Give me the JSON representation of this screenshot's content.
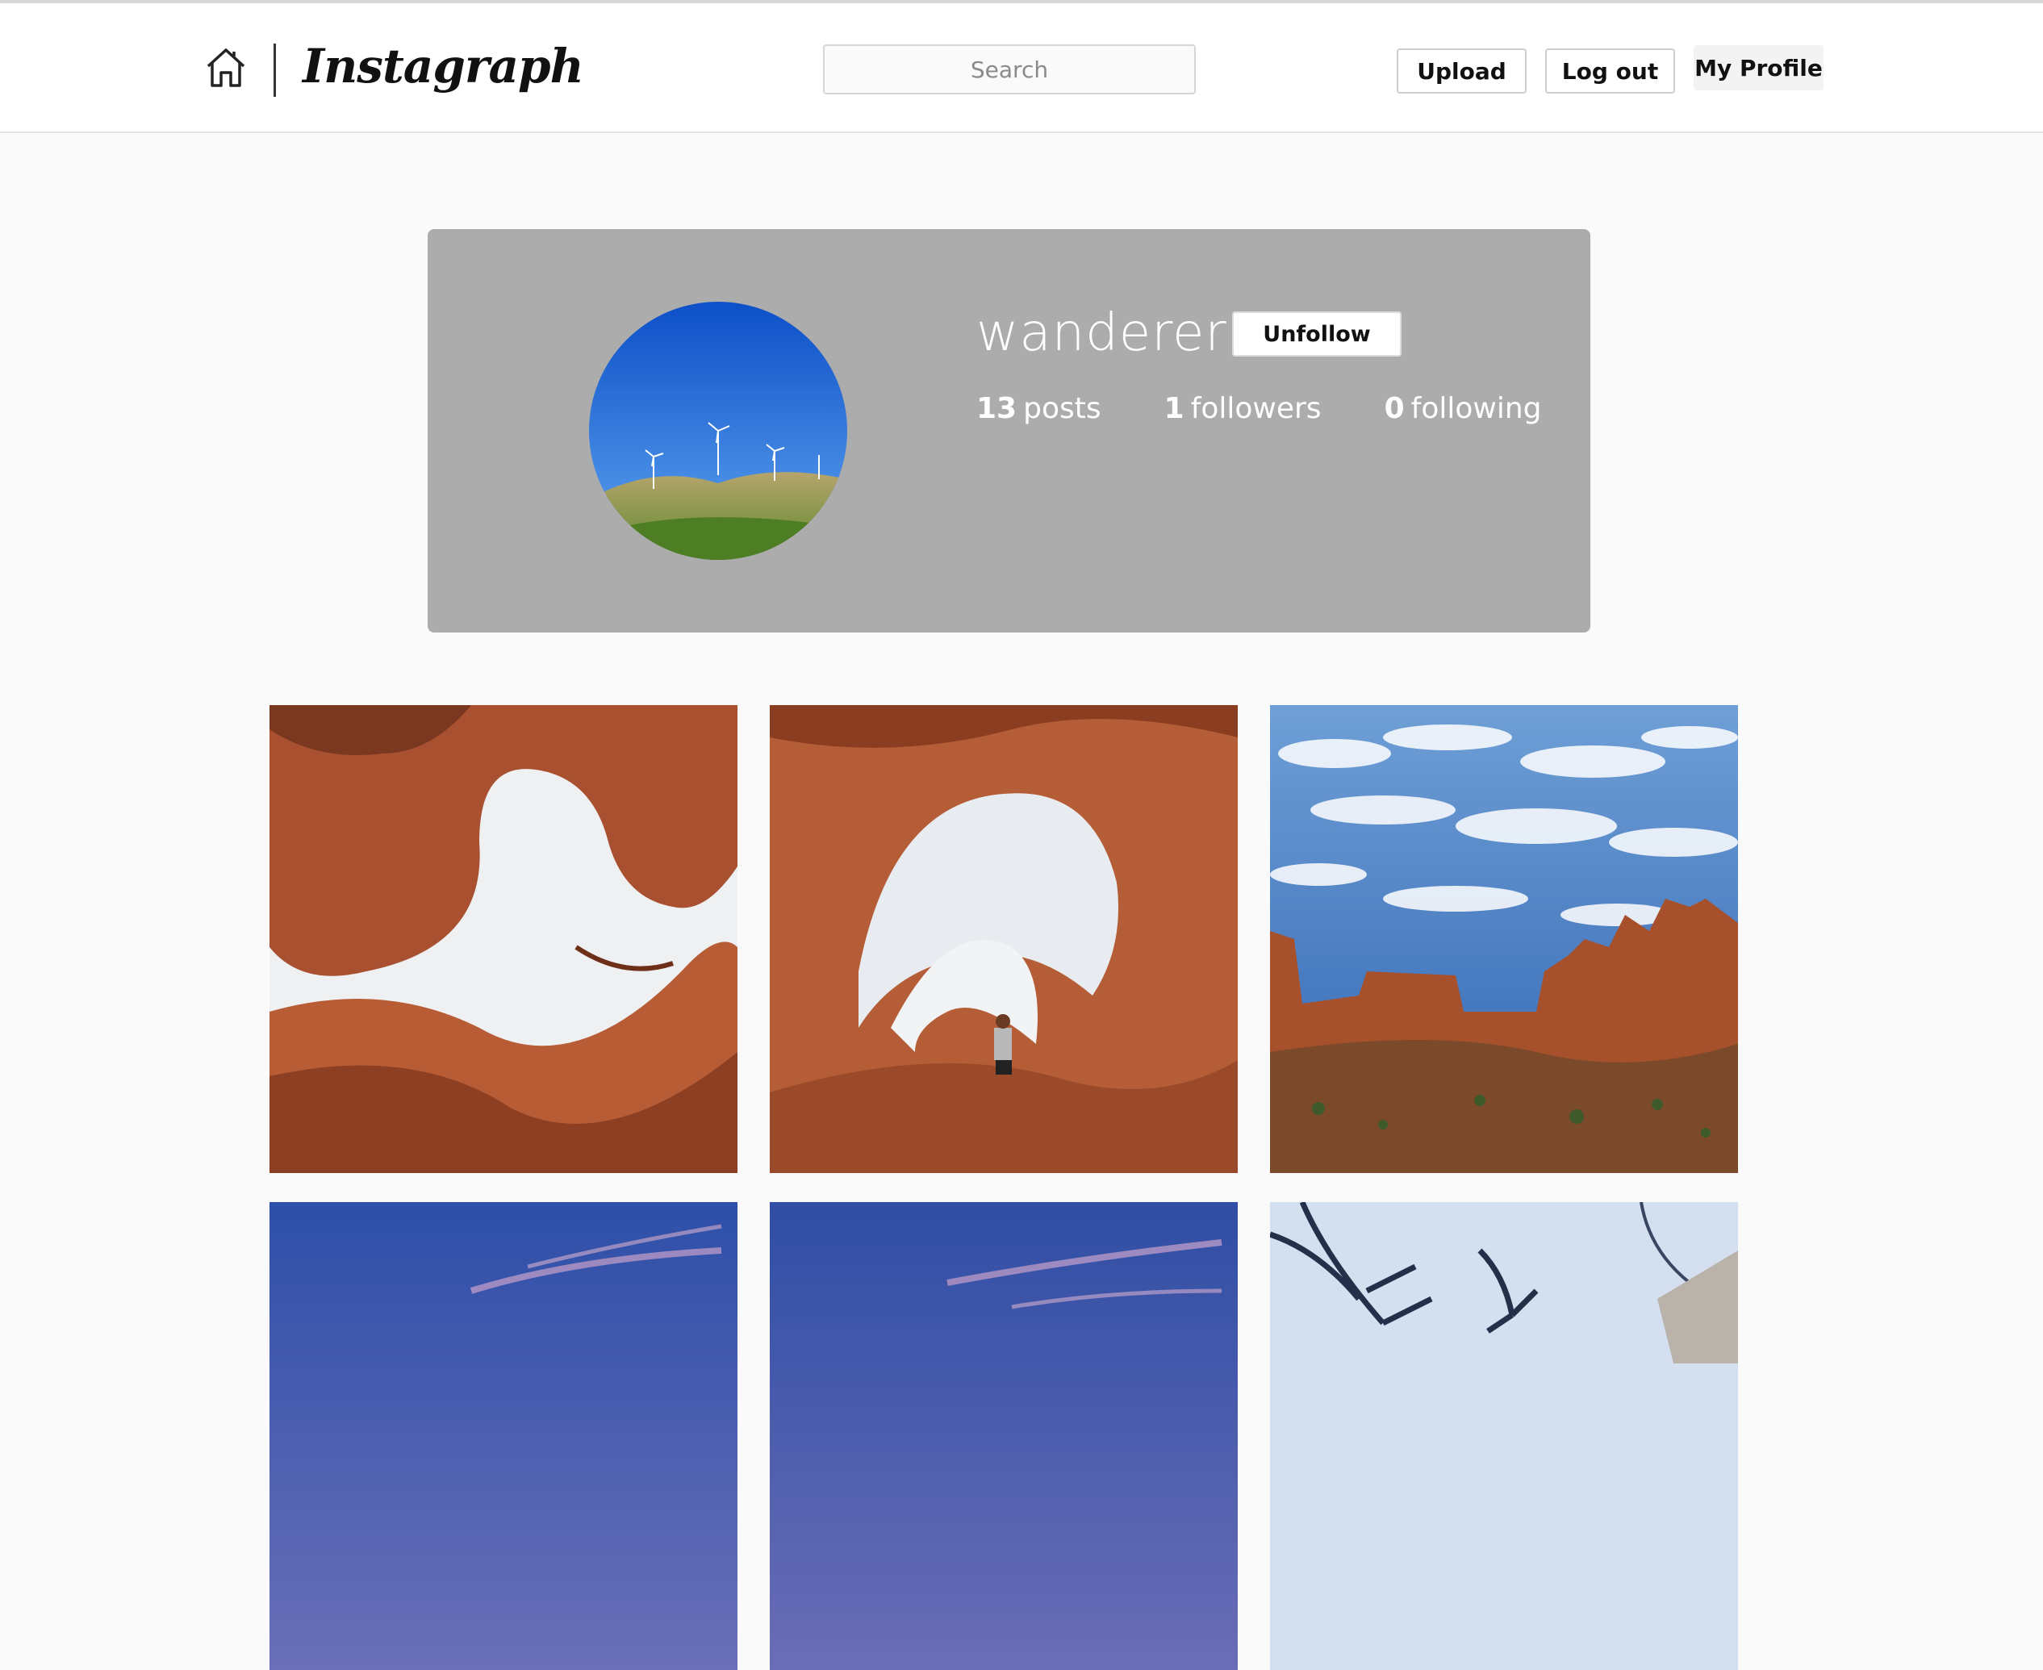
{
  "header": {
    "logo": "Instagraph",
    "search_placeholder": "Search",
    "upload_label": "Upload",
    "logout_label": "Log out",
    "profile_label": "My Profile"
  },
  "profile": {
    "username": "wanderer",
    "follow_button": "Unfollow",
    "posts_count": "13",
    "posts_label": "posts",
    "followers_count": "1",
    "followers_label": "followers",
    "following_count": "0",
    "following_label": "following"
  },
  "posts": [
    {
      "kind": "arch-sky"
    },
    {
      "kind": "double-arch"
    },
    {
      "kind": "cloudy-canyon"
    },
    {
      "kind": "twilight"
    },
    {
      "kind": "twilight"
    },
    {
      "kind": "branches"
    }
  ],
  "colors": {
    "card_bg": "#acacac",
    "page_bg": "#fafafa",
    "header_bg": "#ffffff"
  }
}
